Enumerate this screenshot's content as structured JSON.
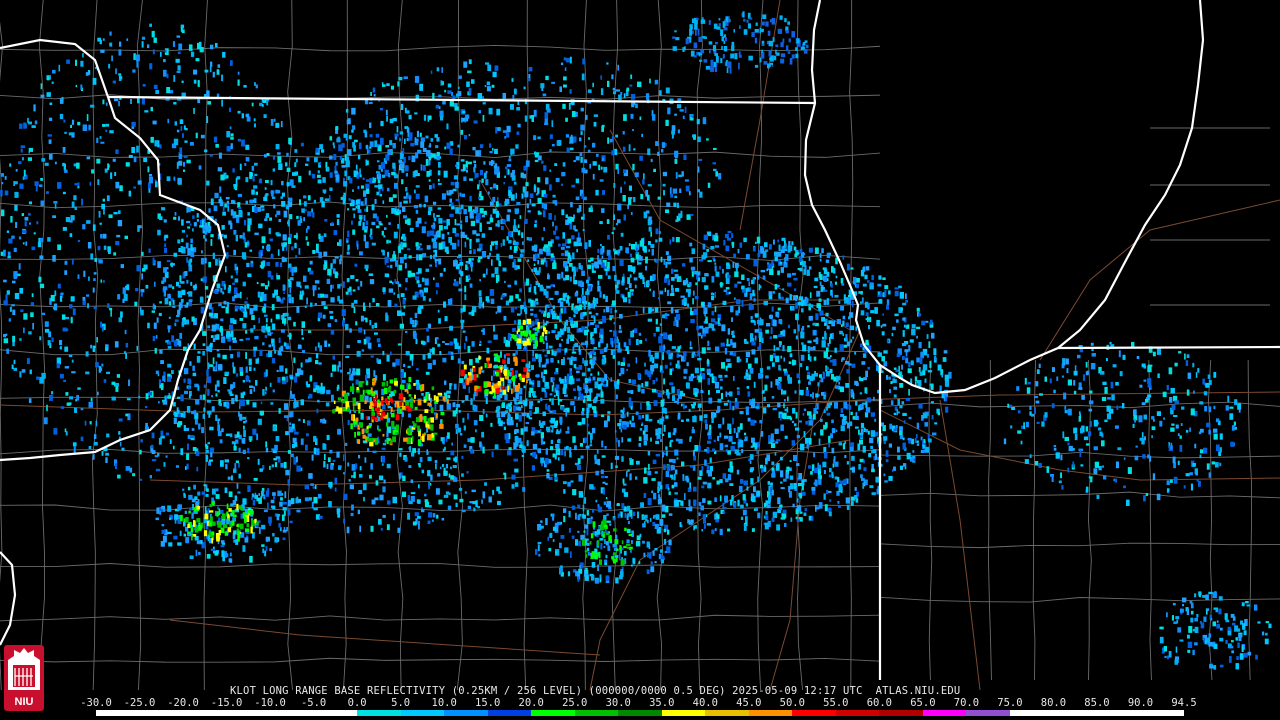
{
  "caption": "KLOT LONG RANGE BASE REFLECTIVITY (0.25KM / 256 LEVEL) (000000/0000 0.5 DEG) 2025-05-09 12:17 UTC  ATLAS.NIU.EDU",
  "scale": {
    "labels": [
      "-30.0",
      "-25.0",
      "-20.0",
      "-15.0",
      "-10.0",
      "-5.0",
      "0.0",
      "5.0",
      "10.0",
      "15.0",
      "20.0",
      "25.0",
      "30.0",
      "35.0",
      "40.0",
      "45.0",
      "50.0",
      "55.0",
      "60.0",
      "65.0",
      "70.0",
      "75.0",
      "80.0",
      "85.0",
      "90.0",
      "94.5"
    ],
    "colors": [
      "#ffffff",
      "#ffffff",
      "#ffffff",
      "#ffffff",
      "#ffffff",
      "#ffffff",
      "#00e0e0",
      "#00c8ff",
      "#0090ff",
      "#0040e0",
      "#00ff00",
      "#00c000",
      "#008800",
      "#ffff00",
      "#e8c000",
      "#ff9000",
      "#ff0000",
      "#d00000",
      "#b00000",
      "#ff00ff",
      "#9050d0",
      "#ffffff",
      "#ffffff",
      "#ffffff",
      "#ffffff"
    ]
  },
  "logo": {
    "text": "NIU"
  }
}
